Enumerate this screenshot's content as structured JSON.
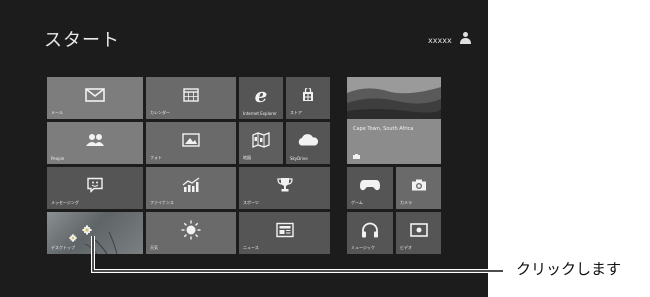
{
  "start": {
    "title": "スタート",
    "username": "xxxxx"
  },
  "tiles": {
    "mail": {
      "label": "メール",
      "icon": "mail-icon"
    },
    "calendar": {
      "label": "カレンダー",
      "icon": "calendar-icon"
    },
    "ie": {
      "label": "Internet Explorer",
      "icon": "internet-explorer-icon"
    },
    "store": {
      "label": "ストア",
      "icon": "store-icon"
    },
    "people": {
      "label": "People",
      "icon": "people-icon"
    },
    "photos": {
      "label": "フォト",
      "icon": "photos-icon"
    },
    "maps": {
      "label": "地図",
      "icon": "maps-icon"
    },
    "skydrive": {
      "label": "SkyDrive",
      "icon": "cloud-icon"
    },
    "messaging": {
      "label": "メッセージング",
      "icon": "messaging-icon"
    },
    "finance": {
      "label": "ファイナンス",
      "icon": "finance-icon"
    },
    "sports": {
      "label": "スポーツ",
      "icon": "trophy-icon"
    },
    "desktop": {
      "label": "デスクトップ",
      "icon": "desktop-wallpaper"
    },
    "weather": {
      "label": "天気",
      "icon": "sun-icon"
    },
    "news": {
      "label": "ニュース",
      "icon": "news-icon"
    },
    "travel": {
      "label": "Cape Town, South Africa",
      "icon": "travel-icon"
    },
    "games": {
      "label": "ゲーム",
      "icon": "gamepad-icon"
    },
    "camera": {
      "label": "カメラ",
      "icon": "camera-icon"
    },
    "music": {
      "label": "ミュージック",
      "icon": "headphones-icon"
    },
    "video": {
      "label": "ビデオ",
      "icon": "video-icon"
    }
  },
  "annotation": {
    "caption": "クリックします"
  }
}
